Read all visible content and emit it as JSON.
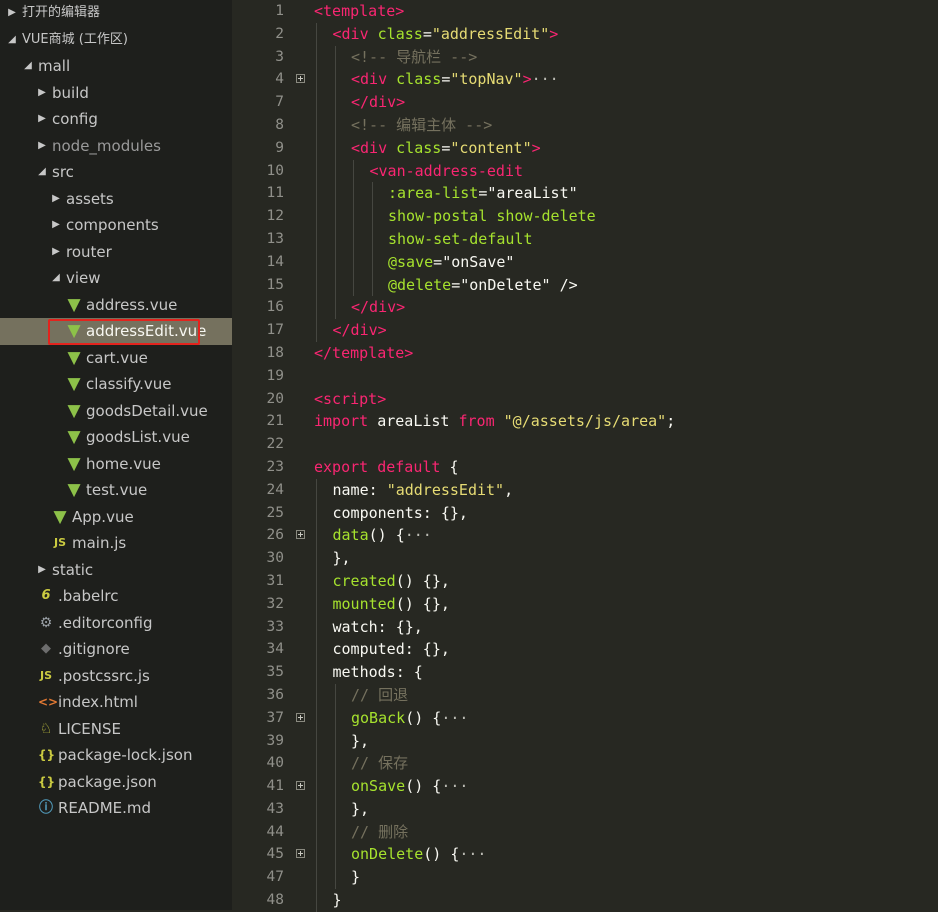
{
  "explorer": {
    "open_editors_label": "打开的编辑器",
    "workspace_label": "VUE商城 (工作区)",
    "tree": [
      {
        "label": "mall",
        "indent": 1,
        "twisty": "open",
        "icon": ""
      },
      {
        "label": "build",
        "indent": 2,
        "twisty": "closed",
        "icon": ""
      },
      {
        "label": "config",
        "indent": 2,
        "twisty": "closed",
        "icon": ""
      },
      {
        "label": "node_modules",
        "indent": 2,
        "twisty": "closed",
        "icon": "",
        "dim": true
      },
      {
        "label": "src",
        "indent": 2,
        "twisty": "open",
        "icon": ""
      },
      {
        "label": "assets",
        "indent": 3,
        "twisty": "closed",
        "icon": ""
      },
      {
        "label": "components",
        "indent": 3,
        "twisty": "closed",
        "icon": ""
      },
      {
        "label": "router",
        "indent": 3,
        "twisty": "closed",
        "icon": ""
      },
      {
        "label": "view",
        "indent": 3,
        "twisty": "open",
        "icon": ""
      },
      {
        "label": "address.vue",
        "indent": 4,
        "twisty": "",
        "icon": "vue-icon"
      },
      {
        "label": "addressEdit.vue",
        "indent": 4,
        "twisty": "",
        "icon": "vue-icon",
        "active": true
      },
      {
        "label": "cart.vue",
        "indent": 4,
        "twisty": "",
        "icon": "vue-icon"
      },
      {
        "label": "classify.vue",
        "indent": 4,
        "twisty": "",
        "icon": "vue-icon"
      },
      {
        "label": "goodsDetail.vue",
        "indent": 4,
        "twisty": "",
        "icon": "vue-icon"
      },
      {
        "label": "goodsList.vue",
        "indent": 4,
        "twisty": "",
        "icon": "vue-icon"
      },
      {
        "label": "home.vue",
        "indent": 4,
        "twisty": "",
        "icon": "vue-icon"
      },
      {
        "label": "test.vue",
        "indent": 4,
        "twisty": "",
        "icon": "vue-icon"
      },
      {
        "label": "App.vue",
        "indent": 3,
        "twisty": "",
        "icon": "vue-icon"
      },
      {
        "label": "main.js",
        "indent": 3,
        "twisty": "",
        "icon": "js-icon"
      },
      {
        "label": "static",
        "indent": 2,
        "twisty": "closed",
        "icon": ""
      },
      {
        "label": ".babelrc",
        "indent": 2,
        "twisty": "",
        "icon": "babel-icon"
      },
      {
        "label": ".editorconfig",
        "indent": 2,
        "twisty": "",
        "icon": "gear-icon"
      },
      {
        "label": ".gitignore",
        "indent": 2,
        "twisty": "",
        "icon": "git-icon"
      },
      {
        "label": ".postcssrc.js",
        "indent": 2,
        "twisty": "",
        "icon": "js-icon"
      },
      {
        "label": "index.html",
        "indent": 2,
        "twisty": "",
        "icon": "html-icon"
      },
      {
        "label": "LICENSE",
        "indent": 2,
        "twisty": "",
        "icon": "license-icon"
      },
      {
        "label": "package-lock.json",
        "indent": 2,
        "twisty": "",
        "icon": "json-icon"
      },
      {
        "label": "package.json",
        "indent": 2,
        "twisty": "",
        "icon": "json-icon"
      },
      {
        "label": "README.md",
        "indent": 2,
        "twisty": "",
        "icon": "info-icon"
      }
    ]
  },
  "editor": {
    "lines": [
      {
        "n": "1",
        "indent": 0,
        "fold": false,
        "tokens": [
          [
            "tag",
            "<template>"
          ]
        ]
      },
      {
        "n": "2",
        "indent": 1,
        "fold": false,
        "tokens": [
          [
            "tag",
            "<div"
          ],
          [
            "txt",
            " "
          ],
          [
            "attr",
            "class"
          ],
          [
            "txt",
            "="
          ],
          [
            "str",
            "\"addressEdit\""
          ],
          [
            "tag",
            ">"
          ]
        ]
      },
      {
        "n": "3",
        "indent": 2,
        "fold": false,
        "tokens": [
          [
            "com",
            "<!-- 导航栏 -->"
          ]
        ]
      },
      {
        "n": "4",
        "indent": 2,
        "fold": true,
        "tokens": [
          [
            "tag",
            "<div"
          ],
          [
            "txt",
            " "
          ],
          [
            "attr",
            "class"
          ],
          [
            "txt",
            "="
          ],
          [
            "str",
            "\"topNav\""
          ],
          [
            "tag",
            ">"
          ],
          [
            "dots",
            "···"
          ]
        ]
      },
      {
        "n": "7",
        "indent": 2,
        "fold": false,
        "tokens": [
          [
            "tag",
            "</div>"
          ]
        ]
      },
      {
        "n": "8",
        "indent": 2,
        "fold": false,
        "tokens": [
          [
            "com",
            "<!-- 编辑主体 -->"
          ]
        ]
      },
      {
        "n": "9",
        "indent": 2,
        "fold": false,
        "tokens": [
          [
            "tag",
            "<div"
          ],
          [
            "txt",
            " "
          ],
          [
            "attr",
            "class"
          ],
          [
            "txt",
            "="
          ],
          [
            "str",
            "\"content\""
          ],
          [
            "tag",
            ">"
          ]
        ]
      },
      {
        "n": "10",
        "indent": 3,
        "fold": false,
        "tokens": [
          [
            "tag",
            "<van-address-edit"
          ]
        ]
      },
      {
        "n": "11",
        "indent": 4,
        "fold": false,
        "tokens": [
          [
            "attr",
            ":area-list"
          ],
          [
            "txt",
            "="
          ],
          [
            "txt",
            "\"areaList\""
          ]
        ]
      },
      {
        "n": "12",
        "indent": 4,
        "fold": false,
        "tokens": [
          [
            "attr",
            "show-postal"
          ],
          [
            "txt",
            " "
          ],
          [
            "attr",
            "show-delete"
          ]
        ]
      },
      {
        "n": "13",
        "indent": 4,
        "fold": false,
        "tokens": [
          [
            "attr",
            "show-set-default"
          ]
        ]
      },
      {
        "n": "14",
        "indent": 4,
        "fold": false,
        "tokens": [
          [
            "attr",
            "@save"
          ],
          [
            "txt",
            "="
          ],
          [
            "txt",
            "\"onSave\""
          ]
        ]
      },
      {
        "n": "15",
        "indent": 4,
        "fold": false,
        "tokens": [
          [
            "attr",
            "@delete"
          ],
          [
            "txt",
            "="
          ],
          [
            "txt",
            "\"onDelete\" />"
          ]
        ]
      },
      {
        "n": "16",
        "indent": 2,
        "fold": false,
        "tokens": [
          [
            "tag",
            "</div>"
          ]
        ]
      },
      {
        "n": "17",
        "indent": 1,
        "fold": false,
        "tokens": [
          [
            "tag",
            "</div>"
          ]
        ]
      },
      {
        "n": "18",
        "indent": 0,
        "fold": false,
        "tokens": [
          [
            "tag",
            "</template>"
          ]
        ]
      },
      {
        "n": "19",
        "indent": 0,
        "fold": false,
        "tokens": []
      },
      {
        "n": "20",
        "indent": 0,
        "fold": false,
        "tokens": [
          [
            "tag",
            "<script>"
          ]
        ]
      },
      {
        "n": "21",
        "indent": 0,
        "fold": false,
        "tokens": [
          [
            "kw",
            "import"
          ],
          [
            "txt",
            " areaList "
          ],
          [
            "kw",
            "from"
          ],
          [
            "txt",
            " "
          ],
          [
            "str",
            "\"@/assets/js/area\""
          ],
          [
            "txt",
            ";"
          ]
        ]
      },
      {
        "n": "22",
        "indent": 0,
        "fold": false,
        "tokens": []
      },
      {
        "n": "23",
        "indent": 0,
        "fold": false,
        "tokens": [
          [
            "kw",
            "export"
          ],
          [
            "txt",
            " "
          ],
          [
            "kw",
            "default"
          ],
          [
            "txt",
            " {"
          ]
        ]
      },
      {
        "n": "24",
        "indent": 1,
        "fold": false,
        "tokens": [
          [
            "txt",
            "name: "
          ],
          [
            "str",
            "\"addressEdit\""
          ],
          [
            "txt",
            ","
          ]
        ]
      },
      {
        "n": "25",
        "indent": 1,
        "fold": false,
        "tokens": [
          [
            "txt",
            "components: {},"
          ]
        ]
      },
      {
        "n": "26",
        "indent": 1,
        "fold": true,
        "tokens": [
          [
            "fn",
            "data"
          ],
          [
            "txt",
            "() {"
          ],
          [
            "dots",
            "···"
          ]
        ]
      },
      {
        "n": "30",
        "indent": 1,
        "fold": false,
        "tokens": [
          [
            "txt",
            "},"
          ]
        ]
      },
      {
        "n": "31",
        "indent": 1,
        "fold": false,
        "tokens": [
          [
            "fn",
            "created"
          ],
          [
            "txt",
            "() {},"
          ]
        ]
      },
      {
        "n": "32",
        "indent": 1,
        "fold": false,
        "tokens": [
          [
            "fn",
            "mounted"
          ],
          [
            "txt",
            "() {},"
          ]
        ]
      },
      {
        "n": "33",
        "indent": 1,
        "fold": false,
        "tokens": [
          [
            "txt",
            "watch: {},"
          ]
        ]
      },
      {
        "n": "34",
        "indent": 1,
        "fold": false,
        "tokens": [
          [
            "txt",
            "computed: {},"
          ]
        ]
      },
      {
        "n": "35",
        "indent": 1,
        "fold": false,
        "tokens": [
          [
            "txt",
            "methods: {"
          ]
        ]
      },
      {
        "n": "36",
        "indent": 2,
        "fold": false,
        "tokens": [
          [
            "com",
            "// 回退"
          ]
        ]
      },
      {
        "n": "37",
        "indent": 2,
        "fold": true,
        "tokens": [
          [
            "fn",
            "goBack"
          ],
          [
            "txt",
            "() {"
          ],
          [
            "dots",
            "···"
          ]
        ]
      },
      {
        "n": "39",
        "indent": 2,
        "fold": false,
        "tokens": [
          [
            "txt",
            "},"
          ]
        ]
      },
      {
        "n": "40",
        "indent": 2,
        "fold": false,
        "tokens": [
          [
            "com",
            "// 保存"
          ]
        ]
      },
      {
        "n": "41",
        "indent": 2,
        "fold": true,
        "tokens": [
          [
            "fn",
            "onSave"
          ],
          [
            "txt",
            "() {"
          ],
          [
            "dots",
            "···"
          ]
        ]
      },
      {
        "n": "43",
        "indent": 2,
        "fold": false,
        "tokens": [
          [
            "txt",
            "},"
          ]
        ]
      },
      {
        "n": "44",
        "indent": 2,
        "fold": false,
        "tokens": [
          [
            "com",
            "// 删除"
          ]
        ]
      },
      {
        "n": "45",
        "indent": 2,
        "fold": true,
        "tokens": [
          [
            "fn",
            "onDelete"
          ],
          [
            "txt",
            "() {"
          ],
          [
            "dots",
            "···"
          ]
        ]
      },
      {
        "n": "47",
        "indent": 2,
        "fold": false,
        "tokens": [
          [
            "txt",
            "}"
          ]
        ]
      },
      {
        "n": "48",
        "indent": 1,
        "fold": false,
        "tokens": [
          [
            "txt",
            "}"
          ]
        ]
      }
    ]
  }
}
